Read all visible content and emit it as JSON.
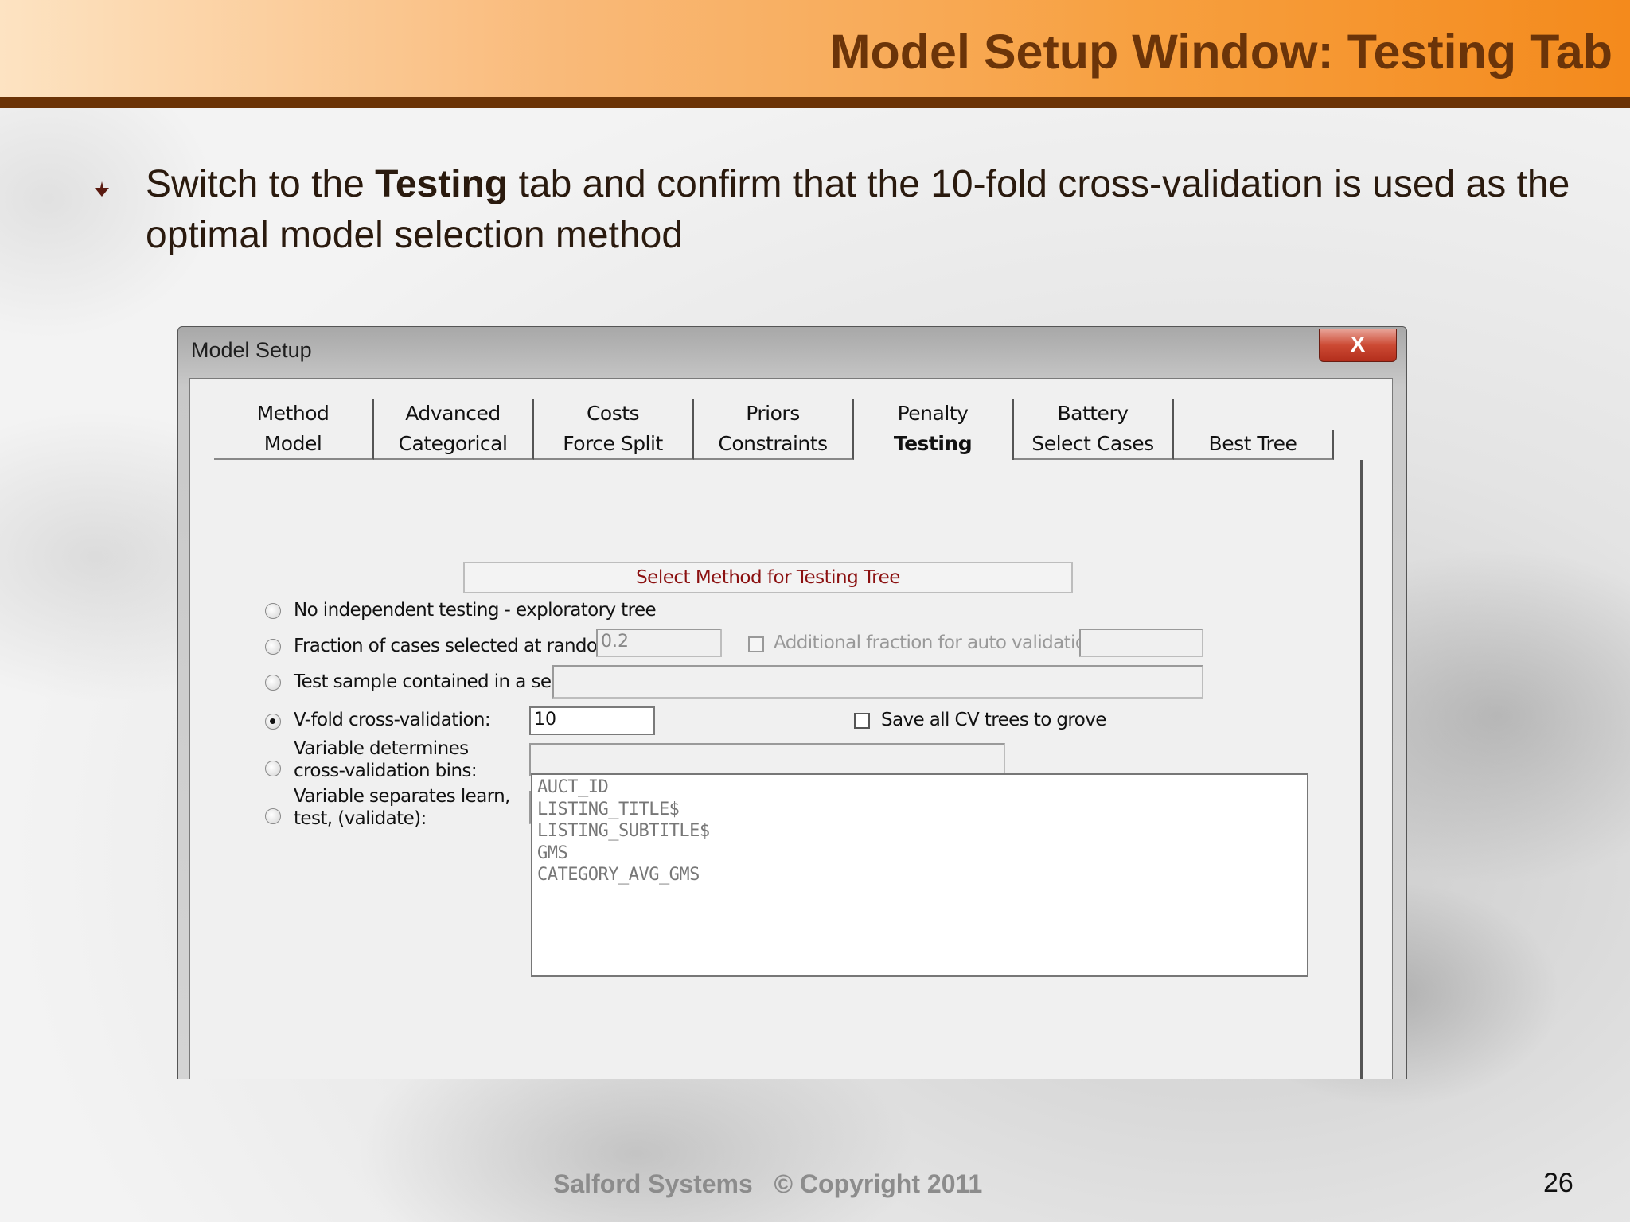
{
  "slide": {
    "title": "Model Setup Window: Testing Tab",
    "bullet_pre": "Switch to the ",
    "bullet_bold": "Testing",
    "bullet_post": " tab and confirm that the 10-fold cross-validation is used as the optimal model selection method",
    "footer": "Salford Systems   © Copyright 2011",
    "page_number": "26"
  },
  "dialog": {
    "title": "Model Setup",
    "close_label": "X",
    "tabs_back": [
      "Method",
      "Advanced",
      "Costs",
      "Priors",
      "Penalty",
      "Battery"
    ],
    "tabs_front": [
      "Model",
      "Categorical",
      "Force Split",
      "Constraints",
      "Testing",
      "Select Cases",
      "Best Tree"
    ],
    "active_tab": "Testing",
    "group_label": "Select Method for Testing Tree",
    "options": {
      "no_testing": "No independent testing - exploratory tree",
      "fraction": "Fraction of cases selected at random for testing:",
      "fraction_value": "0.2",
      "additional_fraction": "Additional fraction for auto validation:",
      "additional_value": "",
      "separate_file": "Test sample contained in a separate file:",
      "separate_file_value": "",
      "vfold": "V-fold cross-validation:",
      "vfold_value": "10",
      "save_cv": "Save all CV trees to grove",
      "var_bins_1": "Variable determines",
      "var_bins_2": "cross-validation bins:",
      "var_bins_value": "",
      "var_sep_1": "Variable separates learn,",
      "var_sep_2": "test, (validate):",
      "var_sep_value": ""
    },
    "selected_option": "vfold",
    "variables": [
      "AUCT_ID",
      "LISTING_TITLE$",
      "LISTING_SUBTITLE$",
      "GMS",
      "CATEGORY_AVG_GMS"
    ]
  }
}
